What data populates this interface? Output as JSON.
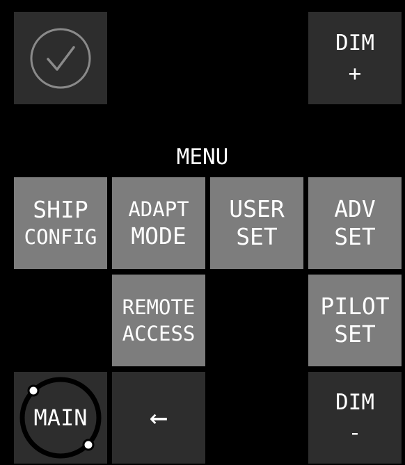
{
  "top": {
    "confirm_icon": "check-circle-icon",
    "dim_plus": {
      "line1": "DIM",
      "line2": "+"
    }
  },
  "menu": {
    "title": "MENU",
    "buttons": {
      "ship_config": {
        "line1": "SHIP",
        "line2": "CONFIG"
      },
      "adapt_mode": {
        "line1": "ADAPT",
        "line2": "MODE"
      },
      "user_set": {
        "line1": "USER",
        "line2": "SET"
      },
      "adv_set": {
        "line1": "ADV",
        "line2": "SET"
      },
      "remote_access": {
        "line1": "REMOTE",
        "line2": "ACCESS"
      },
      "pilot_set": {
        "line1": "PILOT",
        "line2": "SET"
      }
    }
  },
  "bottom": {
    "main": "MAIN",
    "back_arrow": "←",
    "dim_minus": {
      "line1": "DIM",
      "line2": "-"
    }
  },
  "colors": {
    "background": "#000000",
    "dark_button": "#2d2d2d",
    "light_button": "#7d7d7d",
    "text": "#ffffff"
  }
}
